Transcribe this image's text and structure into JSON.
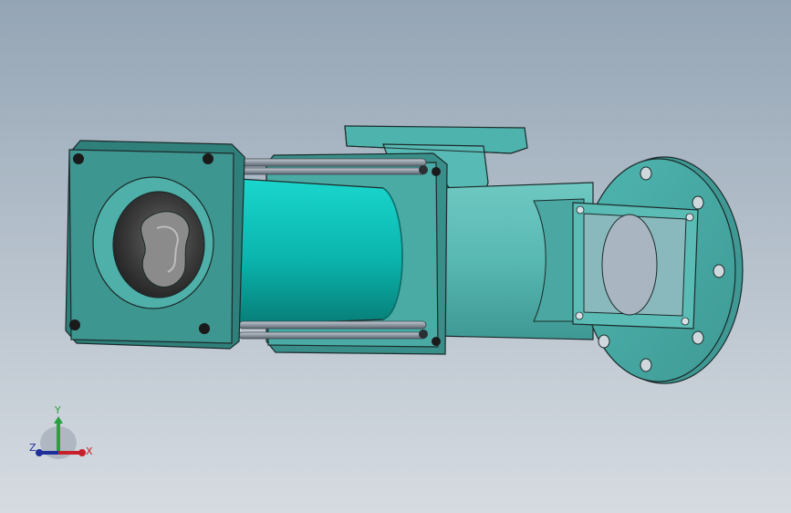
{
  "viewport": {
    "colors": {
      "body": "#4ab3ad",
      "body_light": "#6cc9c3",
      "body_dark": "#2f7f7a",
      "stator_light": "#13d1c8",
      "stator_dark": "#0a8d86",
      "rod": "#9aa3ad",
      "bore": "#3b3b3b",
      "outline": "#1b2b2b"
    }
  },
  "triad": {
    "x_label": "X",
    "y_label": "Y",
    "z_label": "Z",
    "x_color": "#c8202a",
    "y_color": "#2aa043",
    "z_color": "#1e2f9a"
  }
}
